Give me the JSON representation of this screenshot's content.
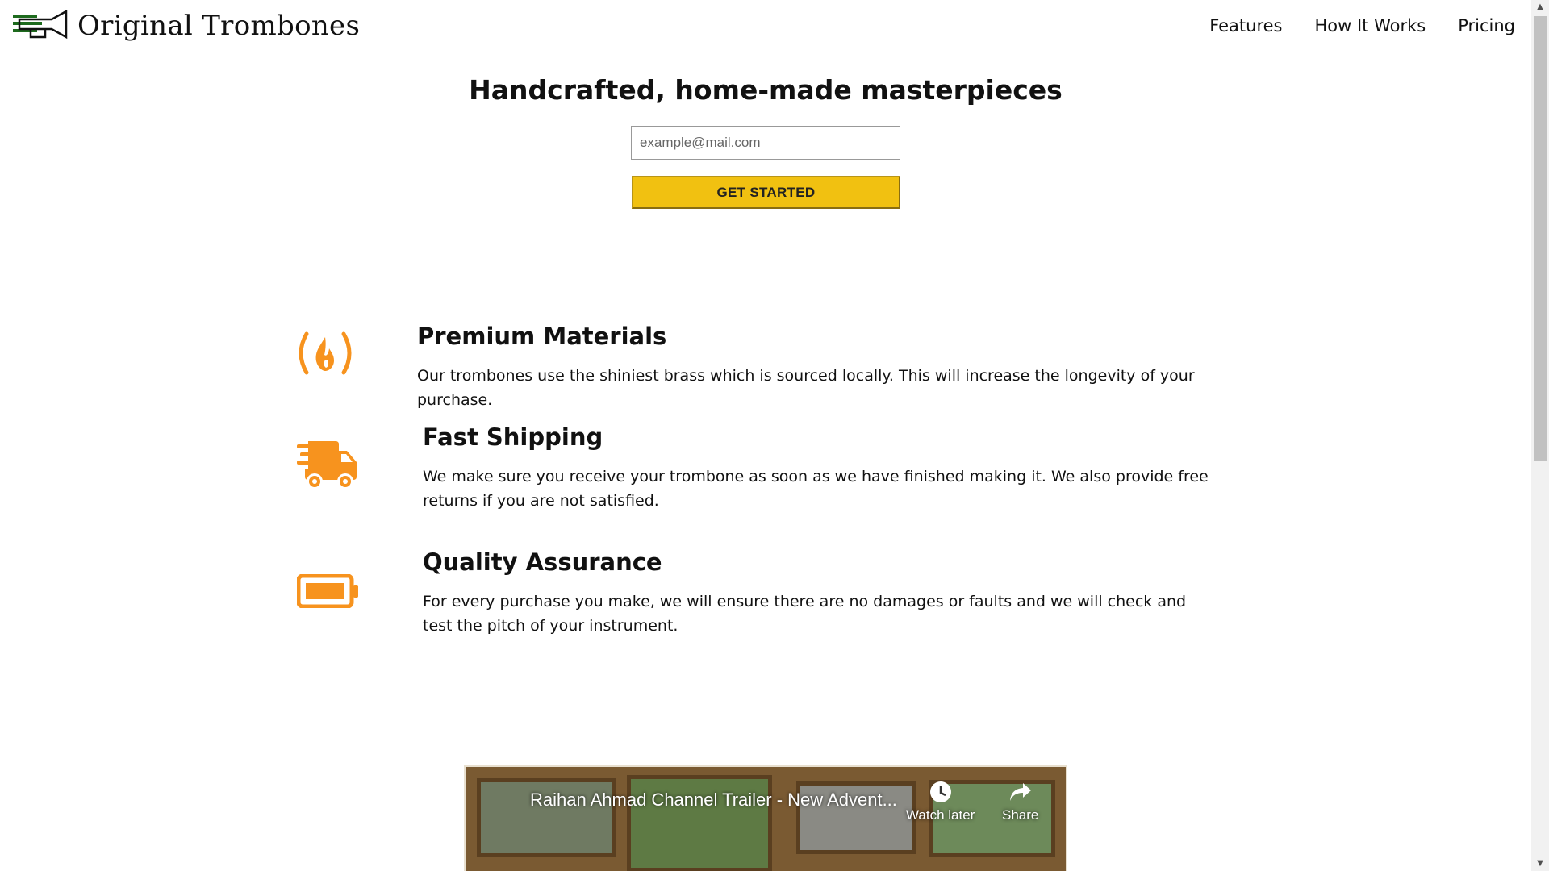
{
  "header": {
    "logo_text": "Original Trombones",
    "nav": [
      {
        "label": "Features"
      },
      {
        "label": "How It Works"
      },
      {
        "label": "Pricing"
      }
    ]
  },
  "hero": {
    "title": "Handcrafted, home-made masterpieces",
    "email_placeholder": "example@mail.com",
    "cta_label": "GET STARTED"
  },
  "features": [
    {
      "icon": "fire-icon",
      "title": "Premium Materials",
      "text": "Our trombones use the shiniest brass which is sourced locally. This will increase the longevity of your purchase."
    },
    {
      "icon": "truck-icon",
      "title": "Fast Shipping",
      "text": "We make sure you receive your trombone as soon as we have finished making it. We also provide free returns if you are not satisfied."
    },
    {
      "icon": "battery-icon",
      "title": "Quality Assurance",
      "text": "For every purchase you make, we will ensure there are no damages or faults and we will check and test the pitch of your instrument."
    }
  ],
  "video": {
    "title": "Raihan Ahmad Channel Trailer - New Advent...",
    "watch_later_label": "Watch later",
    "share_label": "Share"
  },
  "colors": {
    "accent_orange": "#f7931e",
    "cta_yellow": "#f1c111",
    "logo_green": "#1e6b1e"
  }
}
